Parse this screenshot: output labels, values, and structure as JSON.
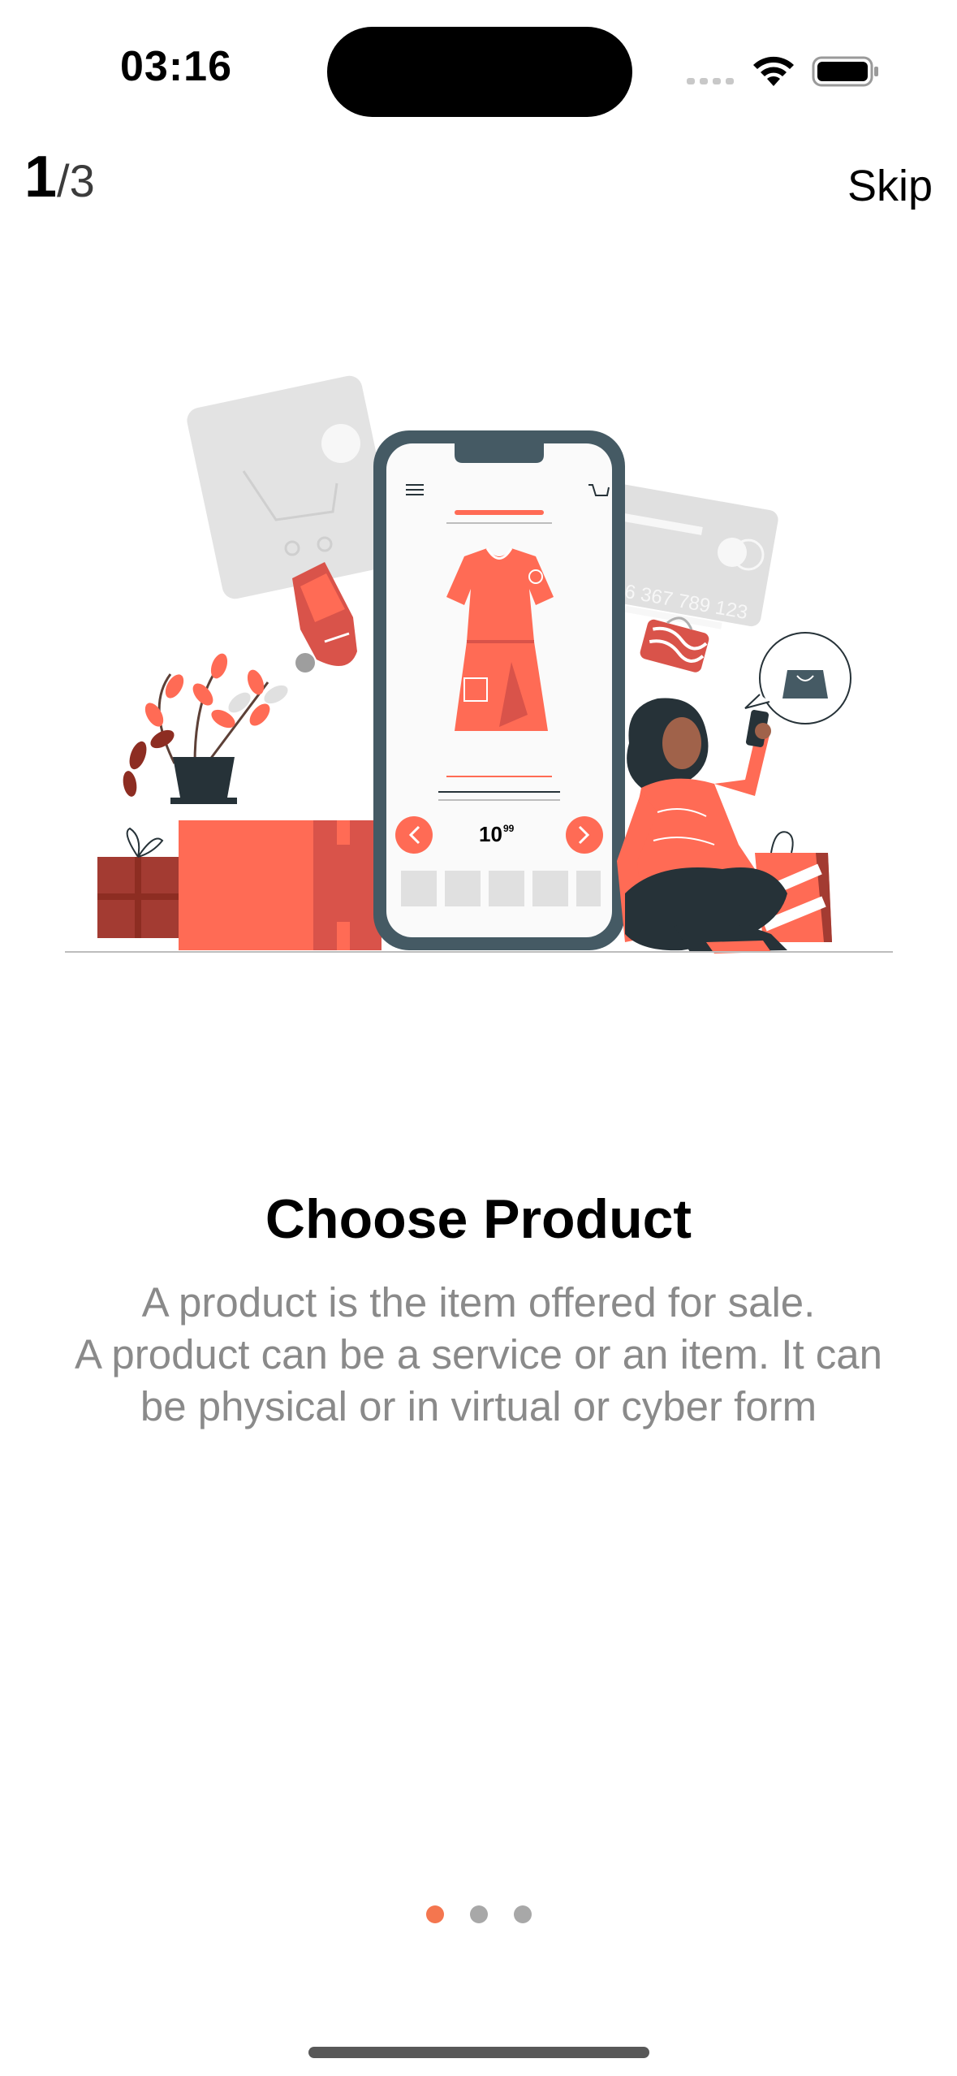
{
  "status_bar": {
    "time": "03:16",
    "icons": [
      "cellular-signal-icon",
      "wifi-icon",
      "battery-icon"
    ]
  },
  "nav": {
    "page_current": "1",
    "page_sep_total": "/3",
    "skip_label": "Skip"
  },
  "illustration": {
    "icon": "online-shopping-illustration",
    "price_main": "10",
    "price_cents": "99",
    "card_number": "456 367 789 123"
  },
  "content": {
    "title": "Choose Product",
    "description_lines": [
      "A product is the item offered for sale.",
      "A product can be a service or an item. It can",
      "be physical or in virtual or cyber form"
    ]
  },
  "pagination": {
    "total": 3,
    "active_index": 0
  },
  "colors": {
    "accent": "#f4764f",
    "dot_inactive": "#a8a8a8",
    "description_text": "#8a8a8a",
    "illustration_coral": "#ff6b55",
    "illustration_dark": "#263238",
    "illustration_gray": "#e0e0e0"
  }
}
